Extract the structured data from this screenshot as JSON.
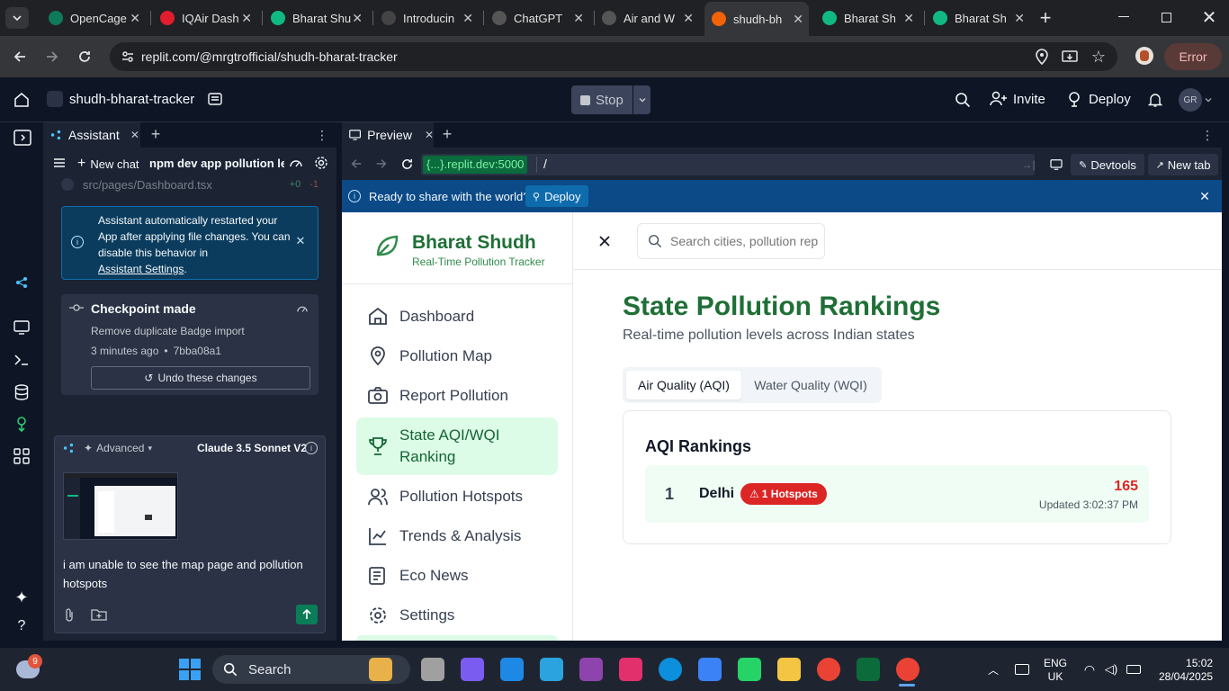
{
  "browser": {
    "tabs": [
      {
        "title": "OpenCage",
        "color": "#0f7a5a"
      },
      {
        "title": "IQAir Dash",
        "color": "#e11d2e"
      },
      {
        "title": "Bharat Shu",
        "color": "#10b981"
      },
      {
        "title": "Introducin",
        "color": "#444"
      },
      {
        "title": "ChatGPT",
        "color": "#555"
      },
      {
        "title": "Air and W",
        "color": "#555"
      },
      {
        "title": "shudh-bh",
        "color": "#f26207"
      },
      {
        "title": "Bharat Sh",
        "color": "#10b981"
      },
      {
        "title": "Bharat Sh",
        "color": "#10b981"
      }
    ],
    "url": "replit.com/@mrgtrofficial/shudh-bharat-tracker",
    "error_label": "Error"
  },
  "replit": {
    "project_name": "shudh-bharat-tracker",
    "stop_label": "Stop",
    "invite_label": "Invite",
    "deploy_label": "Deploy",
    "avatar_initials": "GR"
  },
  "assistant": {
    "tab_label": "Assistant",
    "new_chat_label": "New chat",
    "chat_title": "npm dev app pollution le...",
    "file_name": "src/pages/Dashboard.tsx",
    "file_add": "+0",
    "file_del": "-1",
    "notice_text": "Assistant automatically restarted your App after applying file changes. You can disable this behavior in",
    "notice_link": "Assistant Settings",
    "checkpoint_title": "Checkpoint made",
    "checkpoint_desc": "Remove duplicate Badge import",
    "checkpoint_time": "3 minutes ago",
    "checkpoint_hash": "7bba08a1",
    "undo_label": "Undo these changes",
    "advanced_label": "Advanced",
    "model_label": "Claude 3.5 Sonnet V2",
    "message": "i am unable to see the map page and pollution hotspots"
  },
  "preview": {
    "tab_label": "Preview",
    "url_host": "{...}.replit.dev:5000",
    "url_path": "/",
    "devtools_label": "Devtools",
    "newtab_label": "New tab",
    "banner_text": "Ready to share with the world?",
    "banner_deploy": "Deploy"
  },
  "app": {
    "brand": "Bharat Shudh",
    "tagline": "Real-Time Pollution Tracker",
    "search_placeholder": "Search cities, pollution rep",
    "nav": [
      {
        "label": "Dashboard",
        "icon": "home-icon"
      },
      {
        "label": "Pollution Map",
        "icon": "map-pin-icon"
      },
      {
        "label": "Report Pollution",
        "icon": "camera-icon"
      },
      {
        "label": "State AQI/WQI Ranking",
        "icon": "trophy-icon"
      },
      {
        "label": "Pollution Hotspots",
        "icon": "users-icon"
      },
      {
        "label": "Trends & Analysis",
        "icon": "trend-icon"
      },
      {
        "label": "Eco News",
        "icon": "news-icon"
      },
      {
        "label": "Settings",
        "icon": "gear-icon"
      }
    ],
    "page_title": "State Pollution Rankings",
    "page_subtitle": "Real-time pollution levels across Indian states",
    "tab_aqi": "Air Quality (AQI)",
    "tab_wqi": "Water Quality (WQI)",
    "card_title": "AQI Rankings",
    "ranking": {
      "rank": "1",
      "state": "Delhi",
      "badge": "1 Hotspots",
      "value": "165",
      "updated": "Updated 3:02:37 PM"
    }
  },
  "taskbar": {
    "search_label": "Search",
    "notif_count": "9",
    "lang1": "ENG",
    "lang2": "UK",
    "time": "15:02",
    "date": "28/04/2025"
  }
}
